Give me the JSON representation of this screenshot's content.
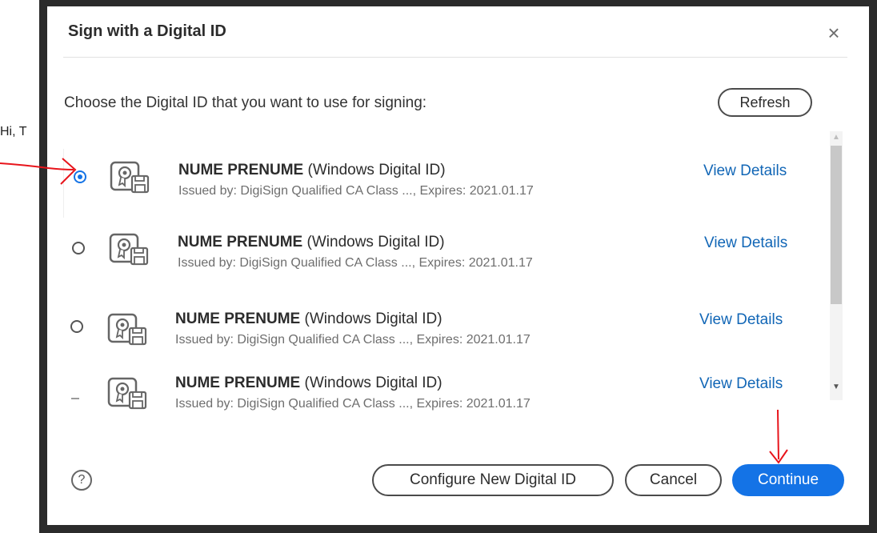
{
  "background": {
    "partial_text": "Hi, T"
  },
  "dialog": {
    "title": "Sign with a Digital ID",
    "prompt": "Choose the Digital ID that you want to use for signing:",
    "refresh_label": "Refresh",
    "ids": [
      {
        "name": "NUME PRENUME",
        "type": "(Windows Digital ID)",
        "issued": "Issued by: DigiSign Qualified CA Class ..., Expires: 2021.01.17",
        "details_label": "View Details",
        "selected": true
      },
      {
        "name": "NUME PRENUME",
        "type": "(Windows Digital ID)",
        "issued": "Issued by: DigiSign Qualified CA Class ..., Expires: 2021.01.17",
        "details_label": "View Details",
        "selected": false
      },
      {
        "name": "NUME PRENUME",
        "type": "(Windows Digital ID)",
        "issued": "Issued by: DigiSign Qualified CA Class ..., Expires: 2021.01.17",
        "details_label": "View Details",
        "selected": false
      },
      {
        "name": "NUME PRENUME",
        "type": "(Windows Digital ID)",
        "issued": "Issued by: DigiSign Qualified CA Class ..., Expires: 2021.01.17",
        "details_label": "View Details",
        "selected": false
      }
    ],
    "help_glyph": "?",
    "close_glyph": "×",
    "configure_label": "Configure New Digital ID",
    "cancel_label": "Cancel",
    "continue_label": "Continue"
  },
  "icons": {
    "close": "close-icon",
    "help": "help-icon",
    "digital_id": "digital-id-certificate-icon",
    "scroll_up": "scroll-up-arrow-icon",
    "scroll_down": "scroll-down-arrow-icon"
  },
  "colors": {
    "accent": "#1473e6",
    "link": "#1166b6",
    "annotation": "#e8141b",
    "frame": "#2b2b2b"
  }
}
